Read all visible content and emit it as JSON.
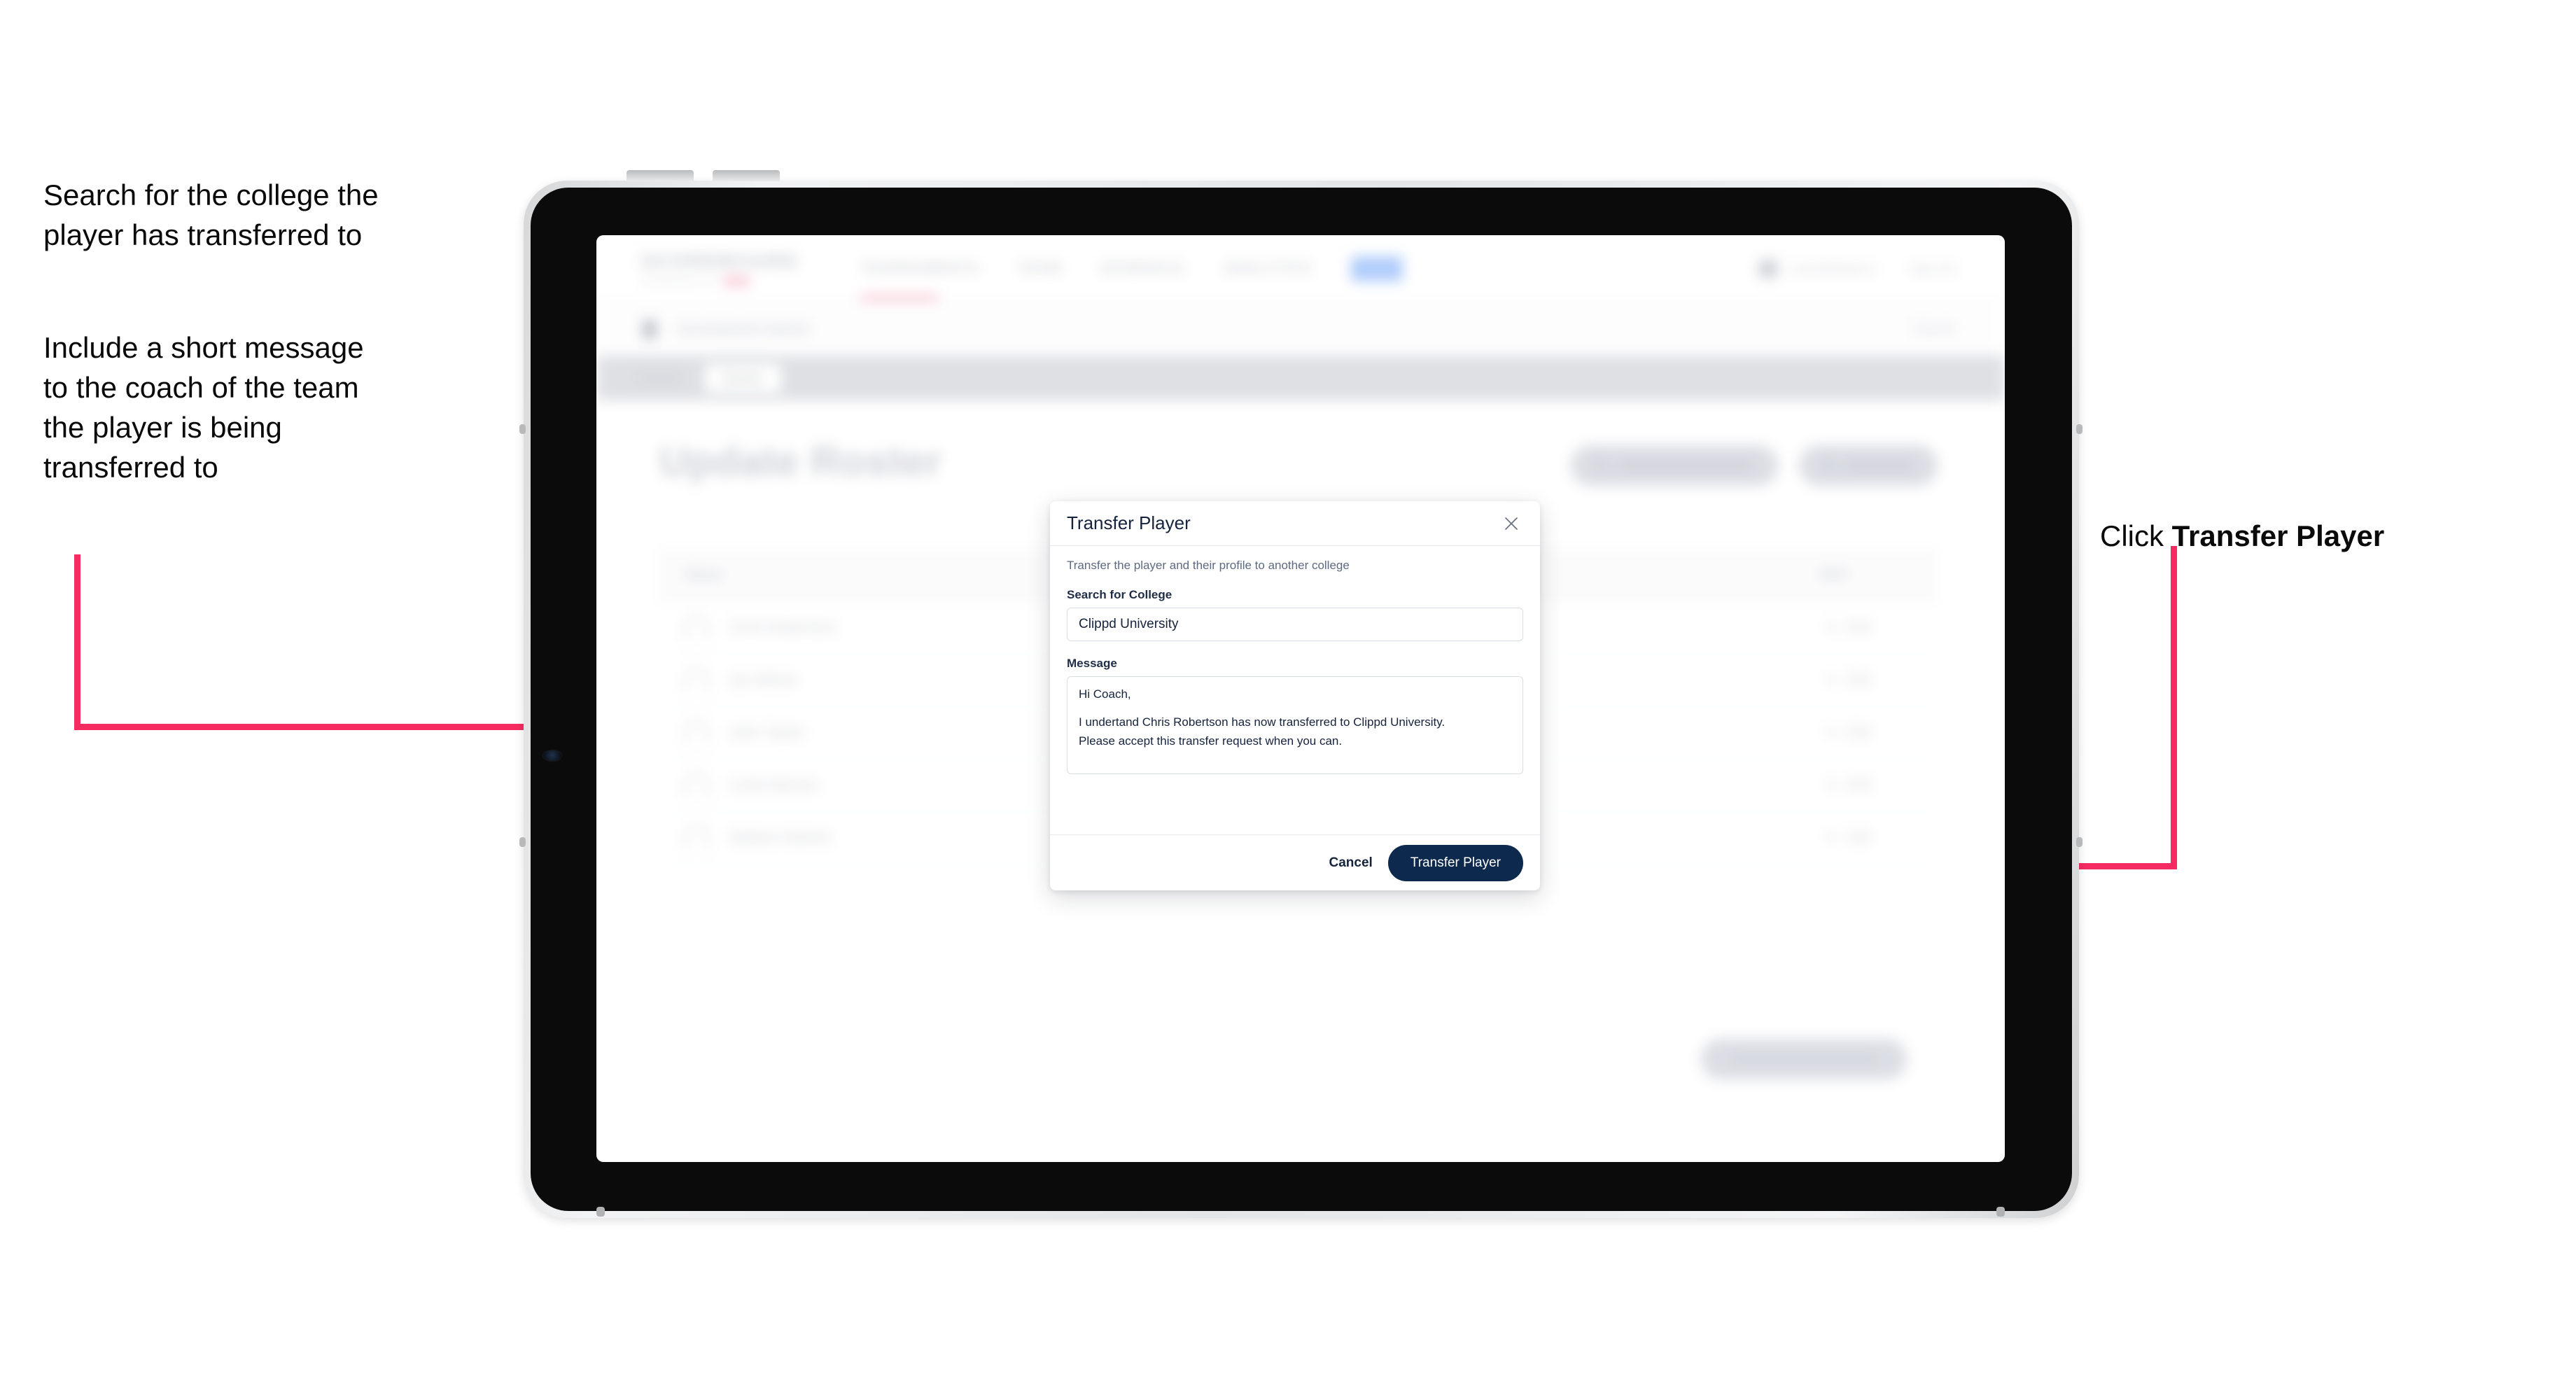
{
  "annotations": {
    "left_1": "Search for the college the\nplayer has transferred to",
    "left_2": "Include a short message\nto the coach of the team\nthe player is being\ntransferred to",
    "right_prefix": "Click ",
    "right_bold": "Transfer Player"
  },
  "colors": {
    "arrow": "#F52B61",
    "primary_button": "#0D2A4E",
    "accent_pink": "#F8A7BD",
    "nav_active_pill": "#9CC0FB"
  },
  "app": {
    "nav": {
      "logo": "SCOREBOARD",
      "logo_sub": "POWERED BY",
      "links": [
        "TOURNAMENTS",
        "TEAM",
        "SCHEDULE",
        "ANALYTICS"
      ],
      "user_email": "coach@clippd.io",
      "user_menu": "Sign Out"
    },
    "subbar": {
      "title": "Scoreboard Admin",
      "action": "Cancel"
    },
    "tabs": {
      "items": [
        "Details",
        "Roster"
      ],
      "active": "Roster"
    },
    "page_title": "Update Roster",
    "header_buttons": [
      "Request Roster Transfer",
      "Add Player"
    ],
    "table": {
      "columns": [
        "Name",
        "EDIT"
      ],
      "rows": [
        {
          "name": "Chris Robertson",
          "edit": "Edit"
        },
        {
          "name": "Ian Wilson",
          "edit": "Edit"
        },
        {
          "name": "John Taylor",
          "edit": "Edit"
        },
        {
          "name": "Lewis Barnes",
          "edit": "Edit"
        },
        {
          "name": "Nathan Holmes",
          "edit": "Edit"
        }
      ]
    },
    "bottom_button": "Save And Continue"
  },
  "modal": {
    "title": "Transfer Player",
    "close_icon": "close-icon",
    "description": "Transfer the player and their profile to another college",
    "college_label": "Search for College",
    "college_value": "Clippd University",
    "college_placeholder": "Search for College",
    "message_label": "Message",
    "message_line_1": "Hi Coach,",
    "message_line_2": "I undertand Chris Robertson has now transferred to Clippd University.",
    "message_line_3": "Please accept this transfer request when you can.",
    "cancel_label": "Cancel",
    "submit_label": "Transfer Player"
  }
}
